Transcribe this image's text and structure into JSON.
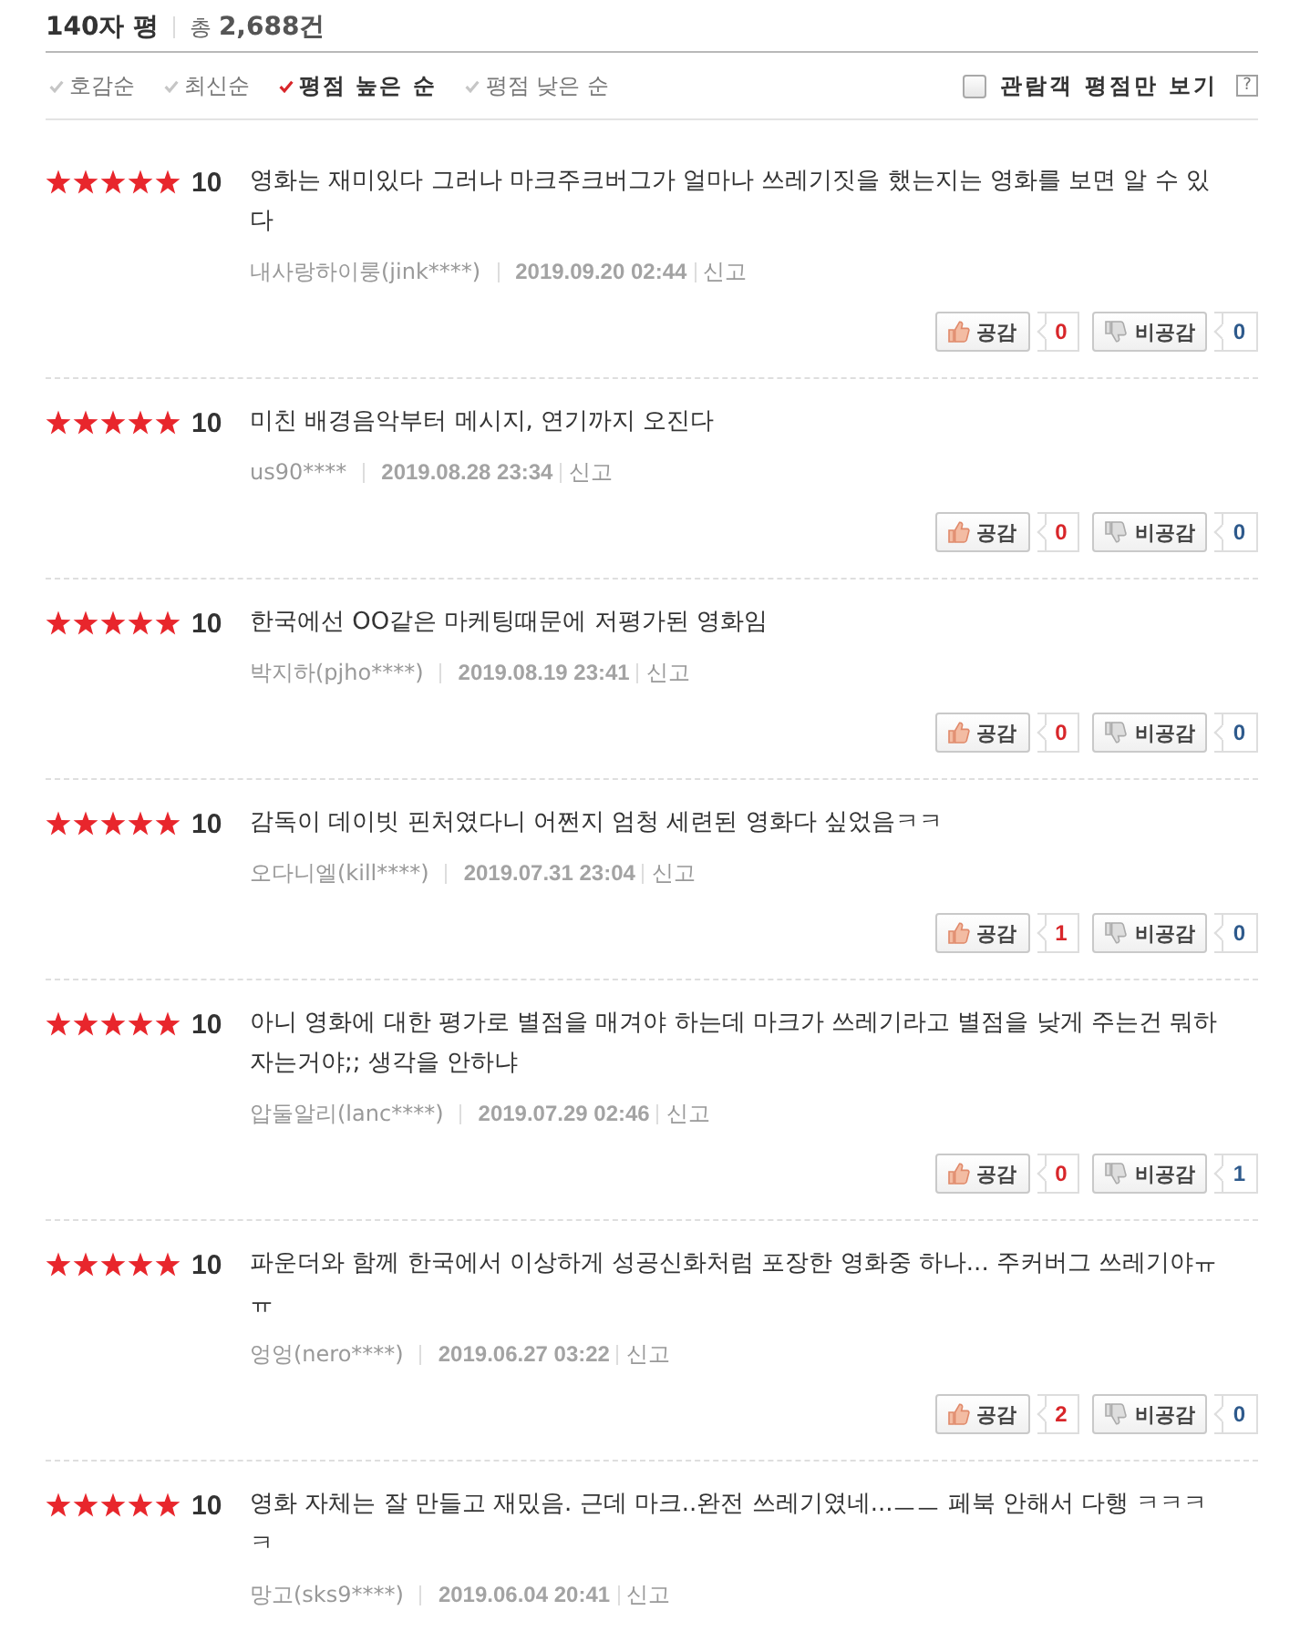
{
  "header": {
    "title": "140자 평",
    "total": "총 **2,688건**"
  },
  "sorts": [
    {
      "label": "호감순",
      "selected": false
    },
    {
      "label": "최신순",
      "selected": false
    },
    {
      "label": "평점 높은 순",
      "selected": true
    },
    {
      "label": "평점 낮은 순",
      "selected": false
    }
  ],
  "audience_filter": {
    "label": "관람객 평점만 보기",
    "checked": false,
    "help": "?"
  },
  "reviews": [
    {
      "stars": 5,
      "score": "10",
      "text": "영화는 재미있다 그러나 마크주크버그가 얼마나 쓰레기짓을 했는지는 영화를 보면 알 수 있다",
      "author": "내사랑하이룽(jink****)",
      "date": "2019.09.20 02:44",
      "report": "신고",
      "like_label": "공감",
      "likes": "0",
      "dislike_label": "비공감",
      "dislikes": "0"
    },
    {
      "stars": 5,
      "score": "10",
      "text": "미친 배경음악부터 메시지, 연기까지 오진다",
      "author": "us90****",
      "date": "2019.08.28 23:34",
      "report": "신고",
      "like_label": "공감",
      "likes": "0",
      "dislike_label": "비공감",
      "dislikes": "0"
    },
    {
      "stars": 5,
      "score": "10",
      "text": "한국에선 OO같은 마케팅때문에 저평가된 영화임",
      "author": "박지하(pjho****)",
      "date": "2019.08.19 23:41",
      "report": "신고",
      "like_label": "공감",
      "likes": "0",
      "dislike_label": "비공감",
      "dislikes": "0"
    },
    {
      "stars": 5,
      "score": "10",
      "text": "감독이 데이빗 핀처였다니 어쩐지 엄청 세련된 영화다 싶었음ㅋㅋ",
      "author": "오다니엘(kill****)",
      "date": "2019.07.31 23:04",
      "report": "신고",
      "like_label": "공감",
      "likes": "1",
      "dislike_label": "비공감",
      "dislikes": "0"
    },
    {
      "stars": 5,
      "score": "10",
      "text": "아니 영화에 대한 평가로 별점을 매겨야 하는데 마크가 쓰레기라고 별점을 낮게 주는건 뭐하자는거야;; 생각을 안하냐",
      "author": "압둘알리(lanc****)",
      "date": "2019.07.29 02:46",
      "report": "신고",
      "like_label": "공감",
      "likes": "0",
      "dislike_label": "비공감",
      "dislikes": "1"
    },
    {
      "stars": 5,
      "score": "10",
      "text": "파운더와 함께 한국에서 이상하게 성공신화처럼 포장한 영화중 하나... 주커버그 쓰레기야ㅠㅠ",
      "author": "엉엉(nero****)",
      "date": "2019.06.27 03:22",
      "report": "신고",
      "like_label": "공감",
      "likes": "2",
      "dislike_label": "비공감",
      "dislikes": "0"
    },
    {
      "stars": 5,
      "score": "10",
      "text": "영화 자체는 잘 만들고 재밌음. 근데 마크..완전 쓰레기였네...ㅡㅡ 페북 안해서 다행 ㅋㅋㅋㅋ",
      "author": "망고(sks9****)",
      "date": "2019.06.04 20:41",
      "report": "신고"
    }
  ]
}
